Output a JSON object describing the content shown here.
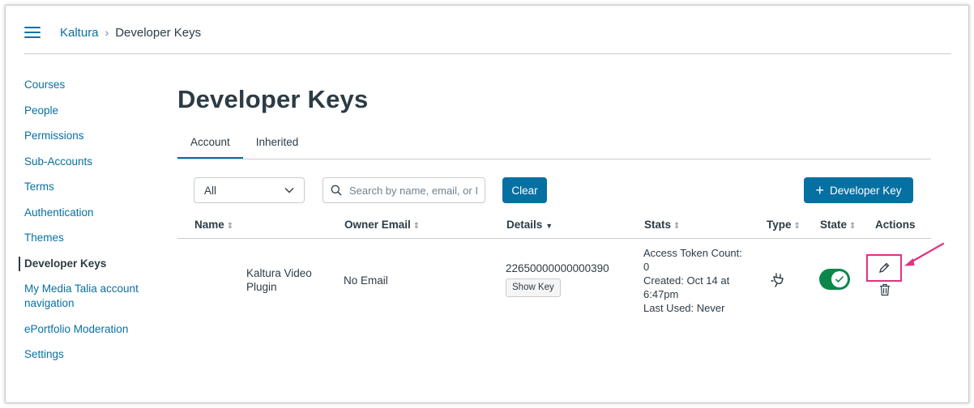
{
  "breadcrumb": {
    "root": "Kaltura",
    "current": "Developer Keys"
  },
  "sidebar": {
    "items": [
      {
        "label": "Courses"
      },
      {
        "label": "People"
      },
      {
        "label": "Permissions"
      },
      {
        "label": "Sub-Accounts"
      },
      {
        "label": "Terms"
      },
      {
        "label": "Authentication"
      },
      {
        "label": "Themes"
      },
      {
        "label": "Developer Keys",
        "active": true
      },
      {
        "label": "My Media Talia account navigation"
      },
      {
        "label": "ePortfolio Moderation"
      },
      {
        "label": "Settings"
      }
    ]
  },
  "page": {
    "title": "Developer Keys"
  },
  "tabs": [
    {
      "label": "Account",
      "active": true
    },
    {
      "label": "Inherited"
    }
  ],
  "toolbar": {
    "filter_value": "All",
    "search_placeholder": "Search by name, email, or ID",
    "clear_label": "Clear",
    "add_label": "Developer Key"
  },
  "table": {
    "headers": {
      "name": "Name",
      "email": "Owner Email",
      "details": "Details",
      "stats": "Stats",
      "type": "Type",
      "state": "State",
      "actions": "Actions"
    },
    "rows": [
      {
        "name": "Kaltura Video Plugin",
        "email": "No Email",
        "key_id": "22650000000000390",
        "show_key_label": "Show Key",
        "stats": {
          "token_label": "Access Token Count:",
          "token_count": "0",
          "created": "Created: Oct 14 at 6:47pm",
          "last_used": "Last Used: Never"
        },
        "type_icon": "plug-icon",
        "state_on": true
      }
    ]
  },
  "colors": {
    "link": "#0770a3",
    "primary_button": "#0770a3",
    "toggle_on": "#0b874b",
    "highlight": "#e4307f",
    "text": "#2d3b45"
  }
}
